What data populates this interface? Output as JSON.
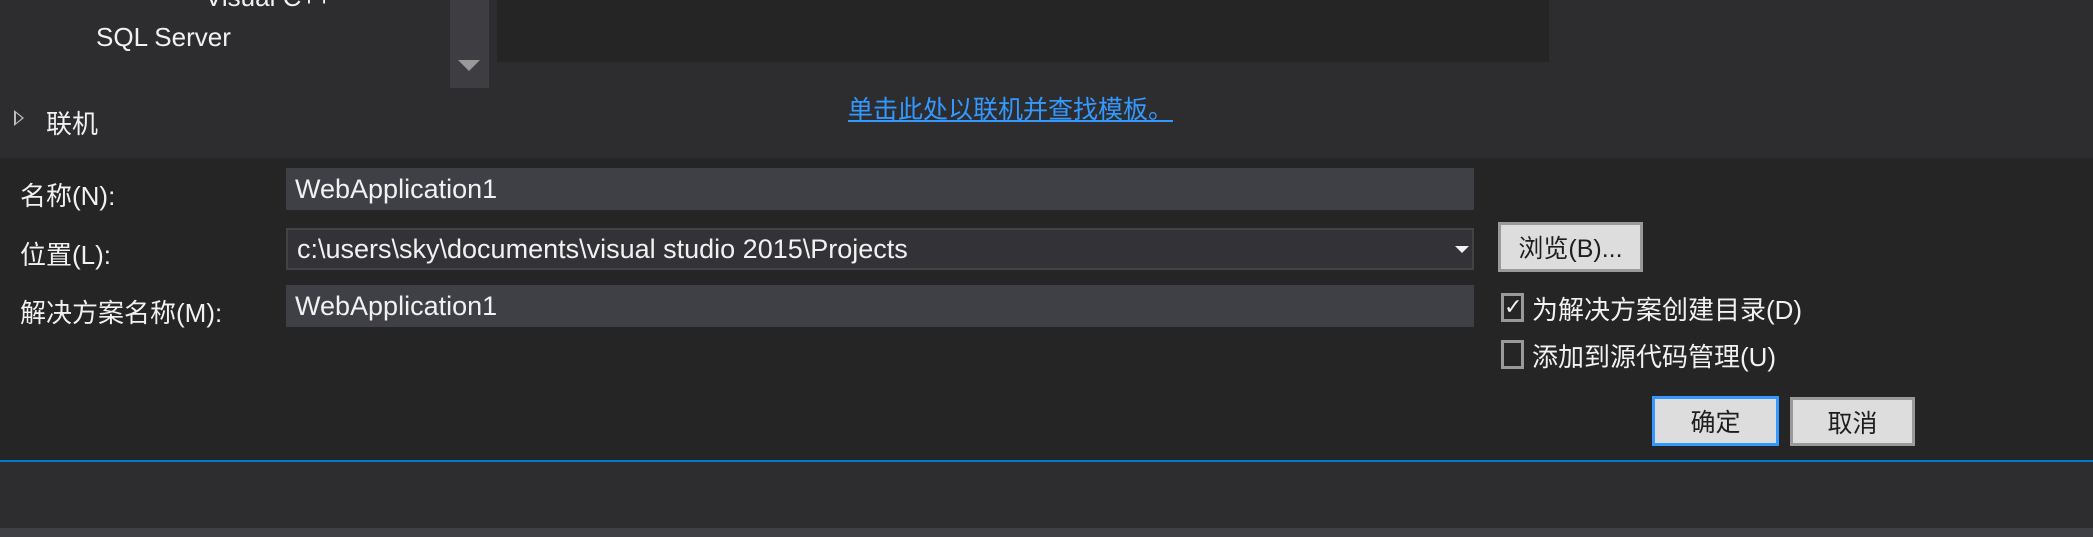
{
  "templates": {
    "partial_item": "Visual C++",
    "sql_item": "SQL Server",
    "online_node": "联机",
    "online_link": "单击此处以联机并查找模板。"
  },
  "form": {
    "name_label": "名称(N):",
    "name_value": "WebApplication1",
    "location_label": "位置(L):",
    "location_value": "c:\\users\\sky\\documents\\visual studio 2015\\Projects",
    "solution_label": "解决方案名称(M):",
    "solution_value": "WebApplication1",
    "browse_label": "浏览(B)...",
    "create_dir_label": "为解决方案创建目录(D)",
    "create_dir_checked": true,
    "source_control_label": "添加到源代码管理(U)",
    "source_control_checked": false,
    "ok_label": "确定",
    "cancel_label": "取消"
  },
  "colors": {
    "accent": "#007acc",
    "link": "#3399ff"
  }
}
